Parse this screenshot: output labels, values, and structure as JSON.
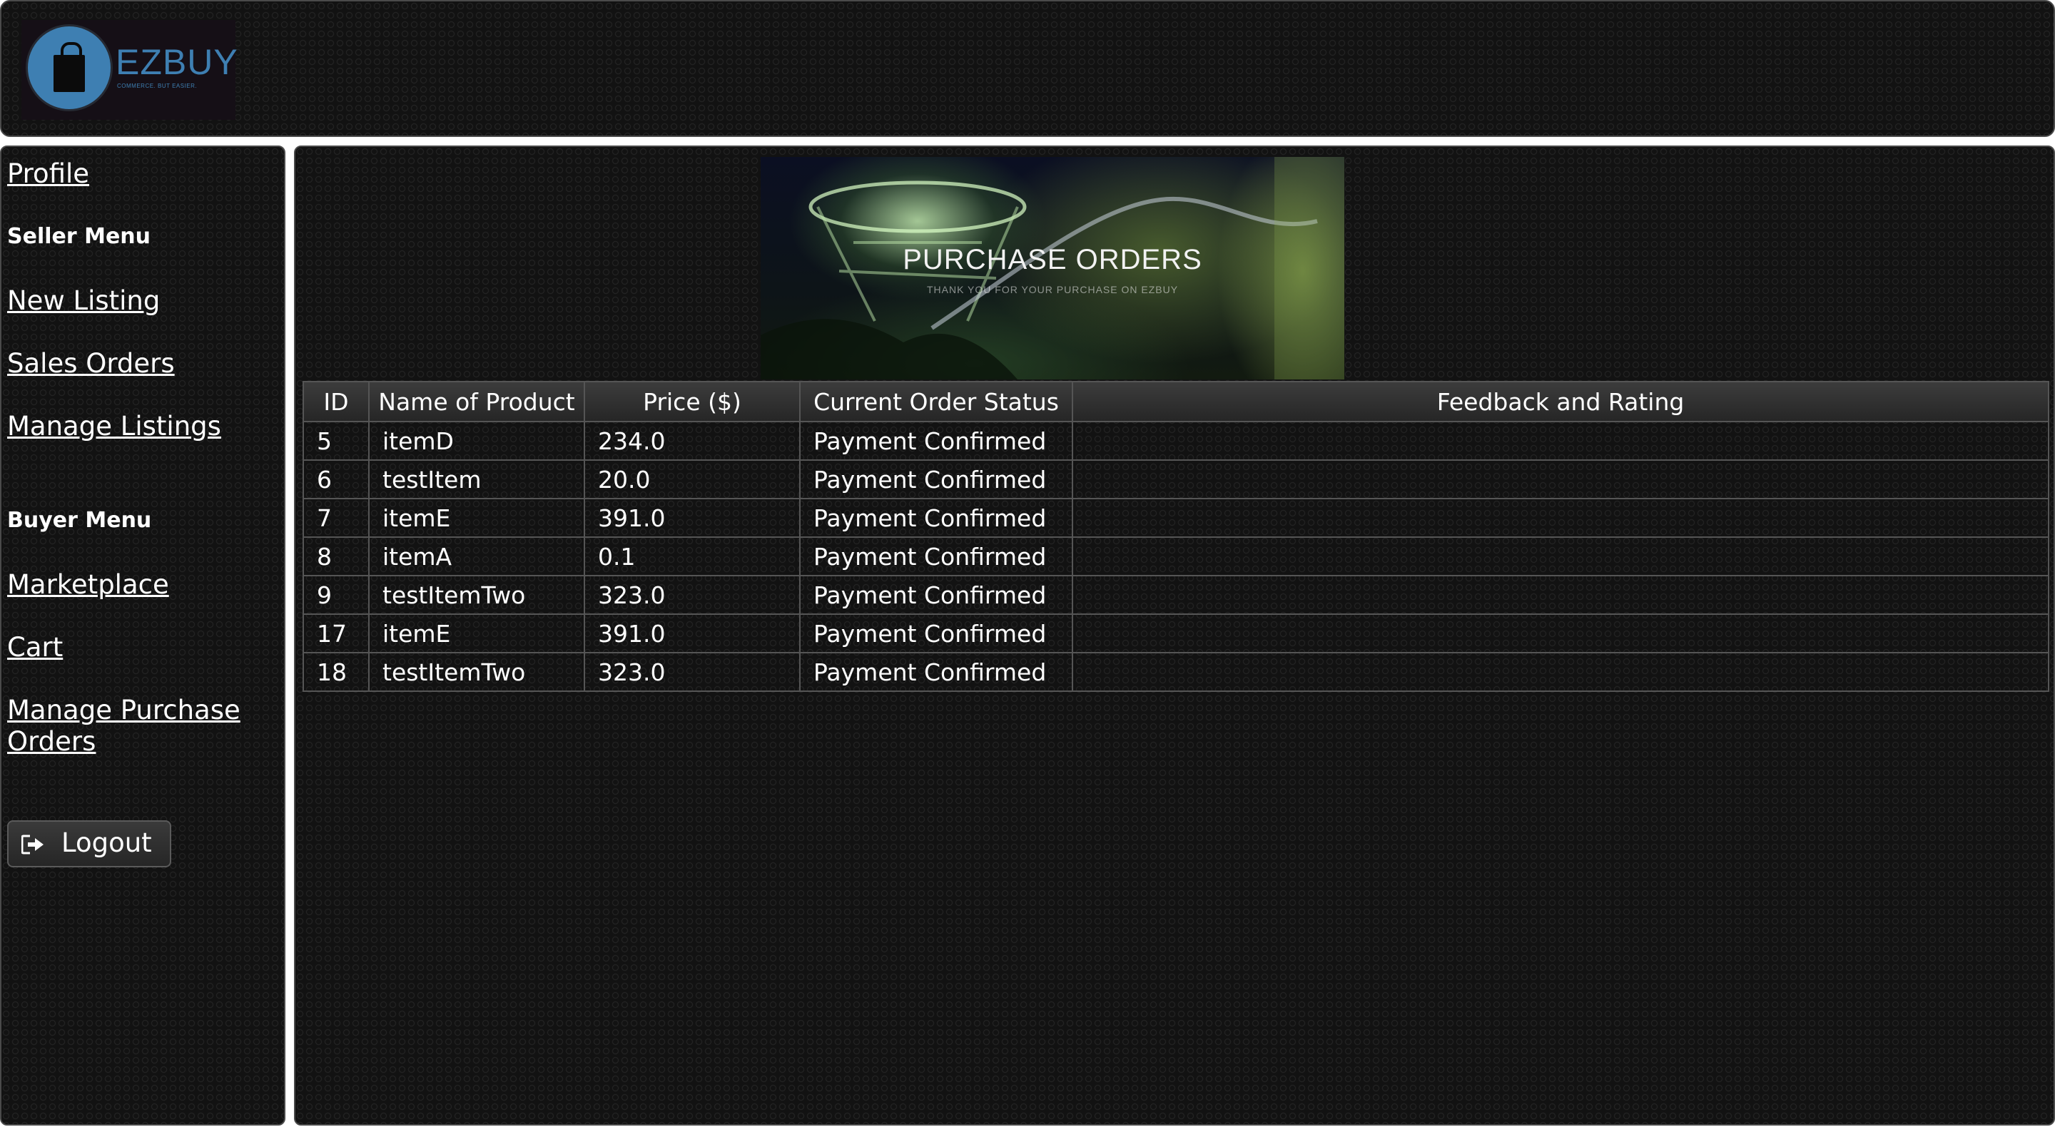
{
  "header": {
    "logo_text": "EZBUY",
    "logo_tagline": "COMMERCE. BUT EASIER."
  },
  "sidebar": {
    "profile_link": "Profile",
    "seller_heading": "Seller Menu",
    "seller_links": [
      "New Listing",
      "Sales Orders",
      "Manage Listings"
    ],
    "buyer_heading": "Buyer Menu",
    "buyer_links": [
      "Marketplace",
      "Cart",
      "Manage Purchase Orders"
    ],
    "logout_label": "Logout",
    "logout_icon": "sign-out-icon"
  },
  "banner": {
    "title": "PURCHASE ORDERS",
    "subtitle": "THANK YOU FOR YOUR PURCHASE ON EZBUY"
  },
  "table": {
    "columns": [
      "ID",
      "Name of Product",
      "Price ($)",
      "Current Order Status",
      "Feedback and Rating"
    ],
    "rows": [
      {
        "id": "5",
        "name": "itemD",
        "price": "234.0",
        "status": "Payment Confirmed",
        "feedback": ""
      },
      {
        "id": "6",
        "name": "testItem",
        "price": "20.0",
        "status": "Payment Confirmed",
        "feedback": ""
      },
      {
        "id": "7",
        "name": "itemE",
        "price": "391.0",
        "status": "Payment Confirmed",
        "feedback": ""
      },
      {
        "id": "8",
        "name": "itemA",
        "price": "0.1",
        "status": "Payment Confirmed",
        "feedback": ""
      },
      {
        "id": "9",
        "name": "testItemTwo",
        "price": "323.0",
        "status": "Payment Confirmed",
        "feedback": ""
      },
      {
        "id": "17",
        "name": "itemE",
        "price": "391.0",
        "status": "Payment Confirmed",
        "feedback": ""
      },
      {
        "id": "18",
        "name": "testItemTwo",
        "price": "323.0",
        "status": "Payment Confirmed",
        "feedback": ""
      }
    ]
  },
  "colors": {
    "background": "#121212",
    "border": "#4a4a4a",
    "logo_blue": "#3e7fb2",
    "text": "#ffffff"
  }
}
